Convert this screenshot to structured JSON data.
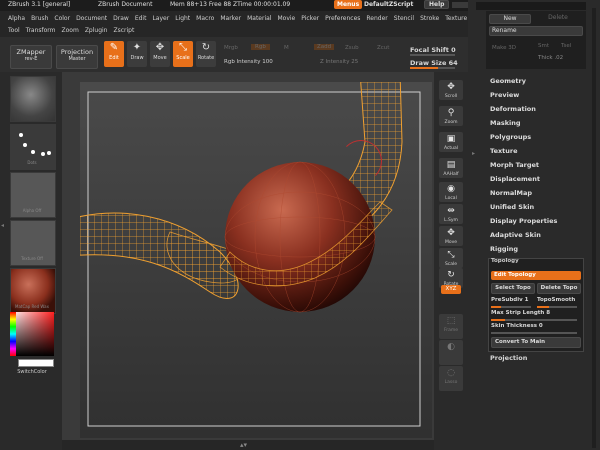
{
  "titlebar": {
    "app_name": "ZBrush 3.1 [general]",
    "doc_name": "ZBrush Document",
    "mem": "Mem 88+13 Free 88 ZTime 00:00:01.09",
    "menus_button": "Menus",
    "script_button": "DefaultZScript",
    "help_button": "Help"
  },
  "menu_row1": [
    "Alpha",
    "Brush",
    "Color",
    "Document",
    "Draw",
    "Edit",
    "Layer",
    "Light",
    "Macro",
    "Marker",
    "Material",
    "Movie",
    "Picker",
    "Preferences",
    "Render",
    "Stencil",
    "Stroke",
    "Texture"
  ],
  "menu_row2": [
    "Tool",
    "Transform",
    "Zoom",
    "Zplugin",
    "Zscript"
  ],
  "toolbar": {
    "zmapper_label": "ZMapper",
    "zmapper_sub": "rev-E",
    "projection_label": "Projection",
    "projection_sub": "Master",
    "edit": "Edit",
    "draw": "Draw",
    "move": "Move",
    "scale": "Scale",
    "rotate": "Rotate",
    "mrgb": "Mrgb",
    "rgb": "Rgb",
    "m": "M",
    "zadd": "Zadd",
    "zsub": "Zsub",
    "zcut": "Zcut",
    "rgb_intensity_label": "Rgb Intensity",
    "rgb_intensity": "100",
    "z_intensity_label": "Z Intensity",
    "z_intensity": "25",
    "focal_shift_label": "Focal Shift",
    "focal_shift": "0",
    "draw_size_label": "Draw Size",
    "draw_size": "64"
  },
  "left_tray": {
    "dots_label": "Dots",
    "alpha_label": "Alpha Off",
    "texture_label": "Texture Off",
    "material_label": "MatCap Red Wax",
    "switch_color": "SwitchColor"
  },
  "shelf": [
    {
      "name": "scroll",
      "label": "Scroll",
      "glyph": "✥"
    },
    {
      "name": "zoom",
      "label": "Zoom",
      "glyph": "⚲"
    },
    {
      "name": "actual",
      "label": "Actual",
      "glyph": "▣"
    },
    {
      "name": "aahalf",
      "label": "AAHalf",
      "glyph": "▤"
    },
    {
      "name": "local",
      "label": "Local",
      "glyph": "◉"
    },
    {
      "name": "lsym",
      "label": "L.Sym",
      "glyph": "⇹"
    },
    {
      "name": "move",
      "label": "Move",
      "glyph": "✥"
    },
    {
      "name": "scale",
      "label": "Scale",
      "glyph": "⤡"
    },
    {
      "name": "rotate",
      "label": "Rotate",
      "glyph": "↻"
    }
  ],
  "shelf_xyz": "XYZ",
  "shelf_lower": [
    {
      "name": "frame",
      "label": "Frame",
      "glyph": "⬚"
    },
    {
      "name": "transp",
      "label": "",
      "glyph": "◐"
    },
    {
      "name": "ghost",
      "label": "Lasso",
      "glyph": "◌"
    }
  ],
  "right_panel": {
    "new": "New",
    "delete": "Delete",
    "rename": "Rename",
    "make_3d": "Make 3D",
    "smt": "Smt",
    "tsel": "Tsel",
    "thick_label": "Thick",
    "thick_value": ".02",
    "sections": [
      "Geometry",
      "Preview",
      "Deformation",
      "Masking",
      "Polygroups",
      "Texture",
      "Morph Target",
      "Displacement",
      "NormalMap",
      "Unified Skin",
      "Display Properties",
      "Adaptive Skin",
      "Rigging"
    ],
    "topology_title": "Topology",
    "edit_topology": "Edit Topology",
    "select_topo": "Select Topo",
    "delete_topo": "Delete Topo",
    "presubdiv_label": "PreSubdiv",
    "presubdiv": "1",
    "topo_smooth": "TopoSmooth",
    "max_strip_label": "Max Strip Length",
    "max_strip": "8",
    "skin_thickness_label": "Skin Thickness",
    "skin_thickness": "0",
    "convert": "Convert To Main",
    "projection": "Projection"
  },
  "colors": {
    "accent": "#e8701a",
    "sphere": "#7a2a1a",
    "wire": "#f0a030"
  }
}
